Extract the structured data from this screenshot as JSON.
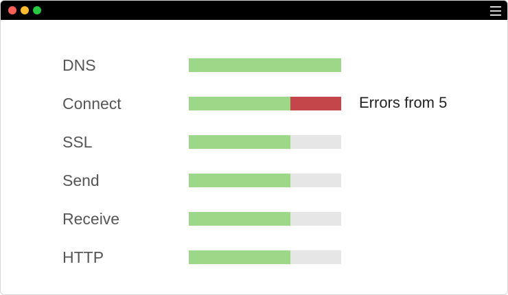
{
  "window": {
    "traffic_lights": [
      {
        "name": "close",
        "color": "#fe5f57"
      },
      {
        "name": "minimize",
        "color": "#febc2e"
      },
      {
        "name": "zoom",
        "color": "#28c840"
      }
    ],
    "menu_icon": "hamburger-menu-icon"
  },
  "colors": {
    "success": "#9dd888",
    "error": "#c4464a",
    "track": "#e6e6e6"
  },
  "rows": [
    {
      "label": "DNS",
      "success_fraction": 1.0,
      "error_fraction": 0.0,
      "note": ""
    },
    {
      "label": "Connect",
      "success_fraction": 0.667,
      "error_fraction": 0.333,
      "note": "Errors from 5"
    },
    {
      "label": "SSL",
      "success_fraction": 0.667,
      "error_fraction": 0.0,
      "note": ""
    },
    {
      "label": "Send",
      "success_fraction": 0.667,
      "error_fraction": 0.0,
      "note": ""
    },
    {
      "label": "Receive",
      "success_fraction": 0.667,
      "error_fraction": 0.0,
      "note": ""
    },
    {
      "label": "HTTP",
      "success_fraction": 0.667,
      "error_fraction": 0.0,
      "note": ""
    }
  ]
}
